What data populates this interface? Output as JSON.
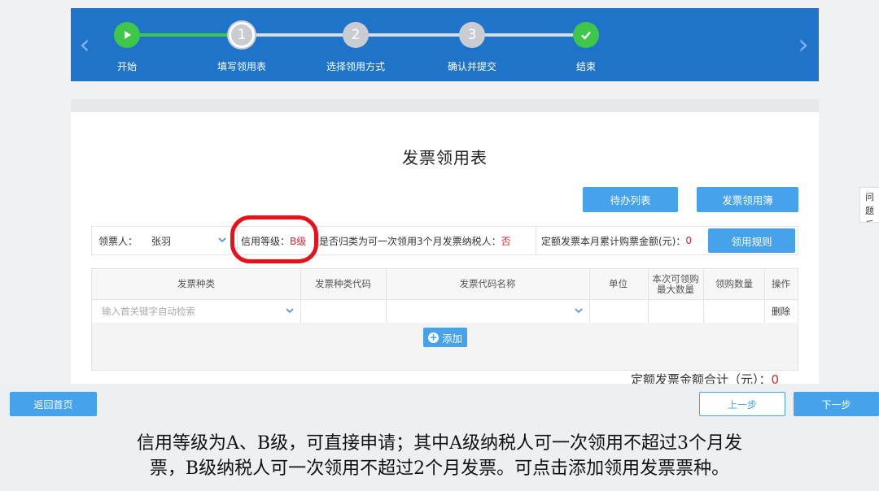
{
  "stepper": {
    "steps": [
      {
        "number": "",
        "label": "开始",
        "state": "done",
        "icon": "play-icon"
      },
      {
        "number": "1",
        "label": "填写领用表",
        "state": "current"
      },
      {
        "number": "2",
        "label": "选择领用方式",
        "state": "pending"
      },
      {
        "number": "3",
        "label": "确认并提交",
        "state": "pending"
      },
      {
        "number": "",
        "label": "结束",
        "state": "done",
        "icon": "check-icon"
      }
    ],
    "left_arrow": "‹",
    "right_arrow": "›"
  },
  "form": {
    "title": "发票领用表",
    "buttons": {
      "pending_list": "待办列表",
      "receipt_book": "发票领用簿",
      "rules": "领用规则"
    },
    "receiver_label": "领票人：",
    "receiver_value": "张羽",
    "credit_label": "信用等级：",
    "credit_value": "B级",
    "quarter_label": "是否归类为可一次领用3个月发票纳税人：",
    "quarter_value": "否",
    "quota_label": "定额发票本月累计购票金额(元)：",
    "quota_value": "0"
  },
  "table": {
    "headers": [
      "发票种类",
      "发票种类代码",
      "发票代码名称",
      "单位",
      "本次可领购最大数量",
      "领购数量",
      "操作"
    ],
    "row": {
      "type_placeholder": "输入首关键字自动检索",
      "action": "删除"
    },
    "add_label": "添加"
  },
  "total": {
    "label": "定额发票金额合计（元）：",
    "value": "0"
  },
  "side_tab": {
    "line1": "问题",
    "line2": "反馈"
  },
  "footer": {
    "home": "返回首页",
    "prev": "上一步",
    "next": "下一步"
  },
  "subtitle": {
    "line1": "信用等级为A、B级，可直接申请；其中A级纳税人可一次领用不超过3个月发",
    "line2": "票，B级纳税人可一次领用不超过2个月发票。可点击添加领用发票票种。"
  },
  "colors": {
    "banner": "#1f74c9",
    "accent": "#46a2eb",
    "done": "#3fc74b",
    "highlight": "#e8111a"
  }
}
